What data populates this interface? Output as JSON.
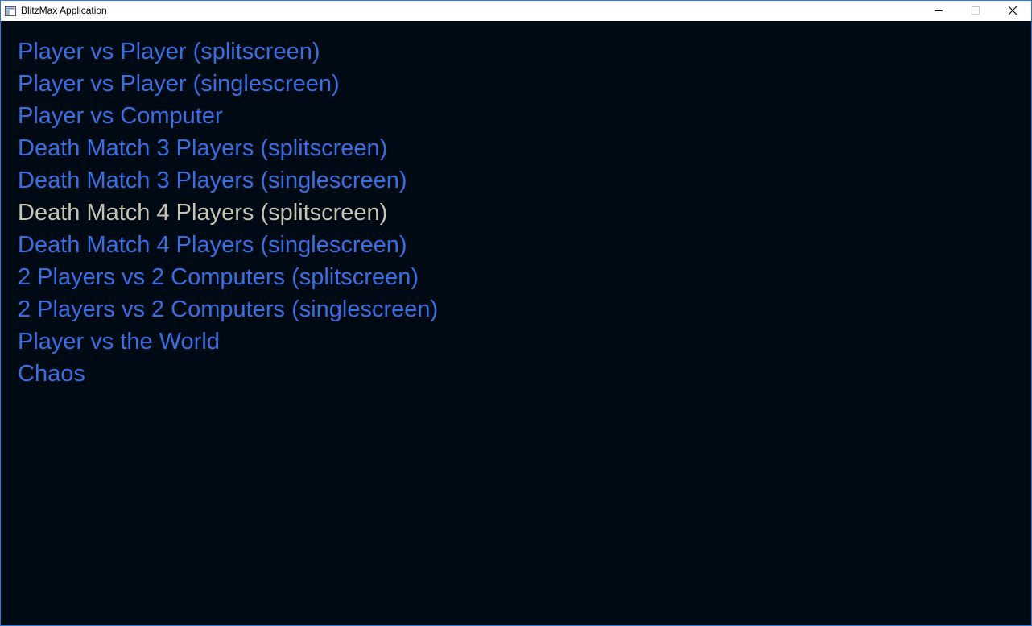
{
  "window": {
    "title": "BlitzMax Application",
    "icon": "app-window-icon",
    "controls": [
      "minimize-icon",
      "maximize-icon",
      "close-icon"
    ]
  },
  "colors": {
    "background": "#000a14",
    "item": "#3a6ee0",
    "selected_item": "#c8c4b2"
  },
  "menu": {
    "selected_index": 5,
    "items": [
      {
        "label": "Player vs Player (splitscreen)"
      },
      {
        "label": "Player vs Player (singlescreen)"
      },
      {
        "label": "Player vs Computer"
      },
      {
        "label": "Death Match 3 Players (splitscreen)"
      },
      {
        "label": "Death Match 3 Players (singlescreen)"
      },
      {
        "label": "Death Match 4 Players (splitscreen)"
      },
      {
        "label": "Death Match 4 Players (singlescreen)"
      },
      {
        "label": "2 Players vs 2 Computers (splitscreen)"
      },
      {
        "label": "2 Players vs 2 Computers (singlescreen)"
      },
      {
        "label": "Player vs the World"
      },
      {
        "label": "Chaos"
      }
    ]
  }
}
